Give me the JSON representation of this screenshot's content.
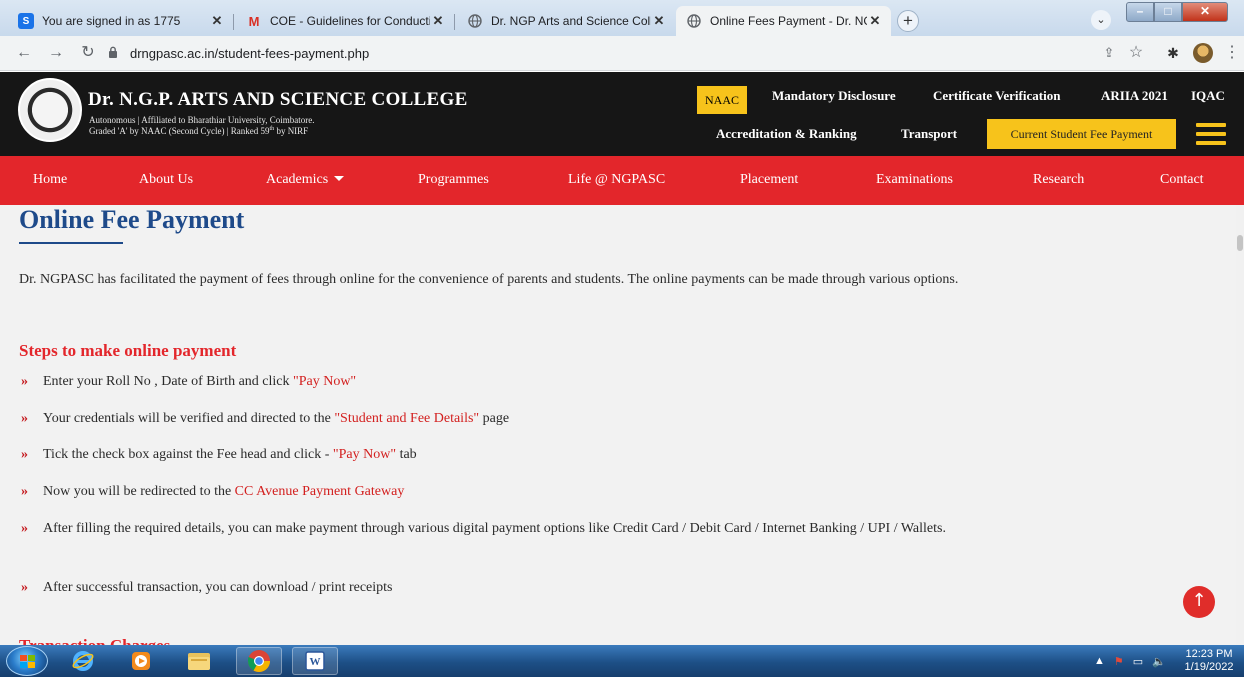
{
  "browser": {
    "tabs": [
      {
        "title": "You are signed in as 1775",
        "favicon": "S",
        "favicon_color": "#1a73e8"
      },
      {
        "title": "COE - Guidelines for Conducting",
        "favicon": "M",
        "favicon_color": "#d93025"
      },
      {
        "title": "Dr. NGP Arts and Science College",
        "favicon": "globe-icon",
        "favicon_color": "#5f6368"
      },
      {
        "title": "Online Fees Payment - Dr. NGP A",
        "favicon": "globe-icon",
        "favicon_color": "#5f6368"
      }
    ],
    "new_tab": "+",
    "url": "drngpasc.ac.in/student-fees-payment.php"
  },
  "header": {
    "college_name": "Dr. N.G.P. ARTS AND SCIENCE COLLEGE",
    "subtitle_1": "Autonomous | Affiliated to Bharathiar University, Coimbatore.",
    "subtitle_2": "Graded 'A' by NAAC (Second Cycle) | Ranked 59",
    "subtitle_2_sup": "th",
    "subtitle_2_tail": " by NIRF",
    "naac": "NAAC",
    "top_links": [
      "Mandatory Disclosure",
      "Certificate Verification",
      "ARIIA 2021",
      "IQAC"
    ],
    "second_links": [
      "Accreditation & Ranking",
      "Transport"
    ],
    "fee_button": "Current Student Fee Payment"
  },
  "nav": {
    "items": [
      "Home",
      "About Us",
      "Academics",
      "Programmes",
      "Life @ NGPASC",
      "Placement",
      "Examinations",
      "Research",
      "Contact"
    ]
  },
  "content": {
    "title": "Online Fee Payment",
    "intro": "Dr. NGPASC has facilitated the payment of fees through online for the convenience of parents and students. The online payments can be made through various options.",
    "steps_heading": "Steps to make online payment",
    "steps": [
      {
        "before": "Enter your Roll No , Date of Birth and click ",
        "highlight": "\"Pay Now\"",
        "after": ""
      },
      {
        "before": "Your credentials will be verified and directed to the ",
        "highlight": "\"Student and Fee Details\"",
        "after": " page"
      },
      {
        "before": "Tick the check box against the Fee head and click - ",
        "highlight": "\"Pay Now\"",
        "after": " tab"
      },
      {
        "before": "Now you will be redirected to the ",
        "highlight": "CC Avenue Payment Gateway",
        "after": ""
      },
      {
        "before": "After filling the required details, you can make payment through various digital payment options like Credit Card / Debit Card / Internet Banking / UPI / Wallets.",
        "highlight": "",
        "after": ""
      },
      {
        "before": "After successful transaction, you can download / print receipts",
        "highlight": "",
        "after": ""
      }
    ],
    "next_heading": "Transaction Charges"
  },
  "taskbar": {
    "time": "12:23 PM",
    "date": "1/19/2022"
  },
  "colors": {
    "nav_red": "#e3262b",
    "header_black": "#161616",
    "accent_yellow": "#f7c31b",
    "title_blue": "#1e4a8a"
  }
}
